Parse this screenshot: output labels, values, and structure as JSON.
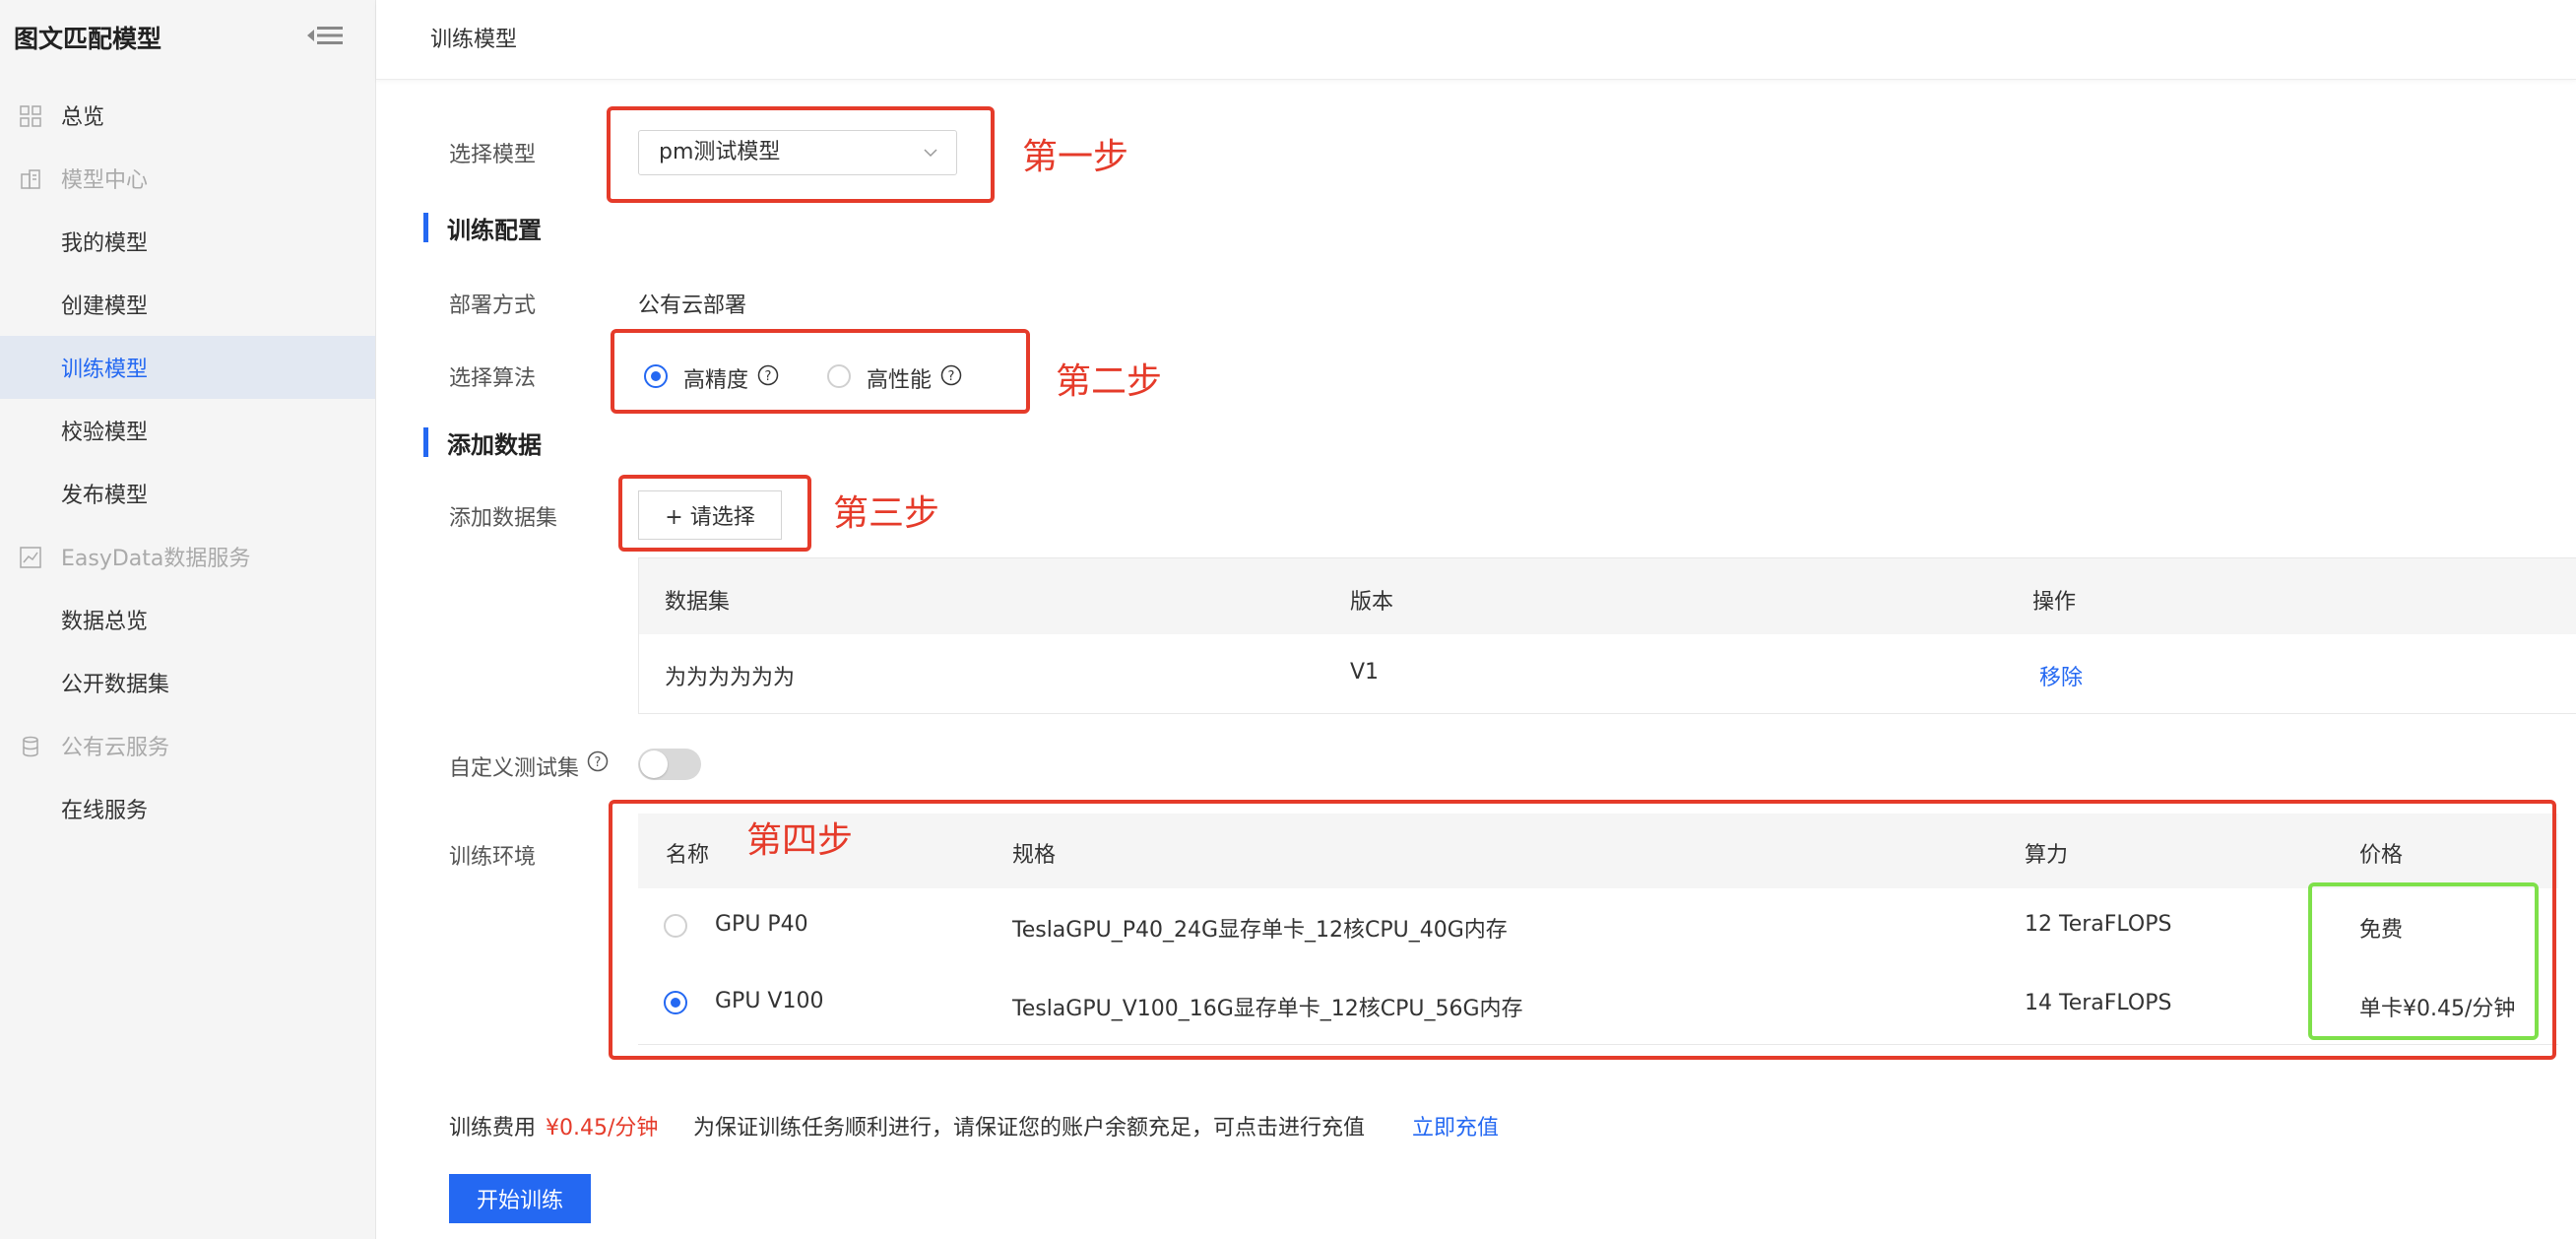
{
  "app_title": "图文匹配模型",
  "header_title": "训练模型",
  "sidebar": {
    "items": [
      {
        "label": "总览",
        "type": "item"
      },
      {
        "label": "模型中心",
        "type": "group"
      },
      {
        "label": "我的模型",
        "type": "sub"
      },
      {
        "label": "创建模型",
        "type": "sub"
      },
      {
        "label": "训练模型",
        "type": "sub",
        "active": true
      },
      {
        "label": "校验模型",
        "type": "sub"
      },
      {
        "label": "发布模型",
        "type": "sub"
      },
      {
        "label": "EasyData数据服务",
        "type": "group"
      },
      {
        "label": "数据总览",
        "type": "sub"
      },
      {
        "label": "公开数据集",
        "type": "sub"
      },
      {
        "label": "公有云服务",
        "type": "group"
      },
      {
        "label": "在线服务",
        "type": "sub"
      }
    ]
  },
  "form": {
    "select_model_label": "选择模型",
    "select_model_value": "pm测试模型",
    "section_train_config": "训练配置",
    "deploy_label": "部署方式",
    "deploy_value": "公有云部署",
    "algo_label": "选择算法",
    "algo_options": [
      {
        "label": "高精度",
        "selected": true
      },
      {
        "label": "高性能",
        "selected": false
      }
    ],
    "section_add_data": "添加数据",
    "add_dataset_label": "添加数据集",
    "add_dataset_button": "+ 请选择",
    "dataset_table": {
      "headers": [
        "数据集",
        "版本",
        "操作"
      ],
      "rows": [
        {
          "name": "为为为为为为",
          "version": "V1",
          "action": "移除"
        }
      ]
    },
    "custom_test_label": "自定义测试集",
    "custom_test_enabled": false,
    "train_env_label": "训练环境",
    "env_table": {
      "headers": [
        "名称",
        "规格",
        "算力",
        "价格"
      ],
      "rows": [
        {
          "name": "GPU  P40",
          "spec": "TeslaGPU_P40_24G显存单卡_12核CPU_40G内存",
          "compute": "12 TeraFLOPS",
          "price": "免费",
          "selected": false
        },
        {
          "name": "GPU  V100",
          "spec": "TeslaGPU_V100_16G显存单卡_12核CPU_56G内存",
          "compute": "14 TeraFLOPS",
          "price": "单卡¥0.45/分钟",
          "selected": true
        }
      ]
    },
    "fee_label": "训练费用",
    "fee_value": "¥0.45/分钟",
    "fee_notice": "为保证训练任务顺利进行，请保证您的账户余额充足，可点击进行充值",
    "recharge_link": "立即充值",
    "start_button": "开始训练"
  },
  "annotations": {
    "step1": "第一步",
    "step2": "第二步",
    "step3": "第三步",
    "step4": "第四步"
  },
  "colors": {
    "accent": "#2468f2",
    "annotation_red": "#e53b2a",
    "annotation_green": "#7ee04a",
    "sidebar_active_bg": "#e2e8f2"
  }
}
